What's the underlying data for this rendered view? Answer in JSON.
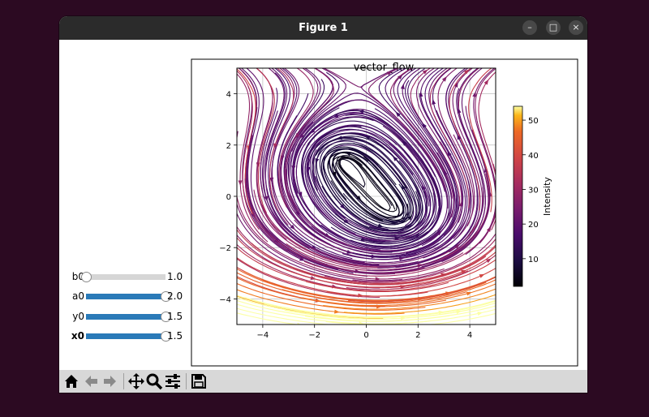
{
  "window": {
    "title": "Figure 1",
    "controls": {
      "minimize": "–",
      "maximize": "□",
      "close": "×"
    }
  },
  "sliders": [
    {
      "name": "b0",
      "value_text": "1.0",
      "fraction": 0.0,
      "bold": false
    },
    {
      "name": "a0",
      "value_text": "2.0",
      "fraction": 1.0,
      "bold": false
    },
    {
      "name": "y0",
      "value_text": "1.5",
      "fraction": 1.0,
      "bold": false
    },
    {
      "name": "x0",
      "value_text": "1.5",
      "fraction": 1.0,
      "bold": true
    }
  ],
  "toolbar": {
    "buttons": [
      "home-icon",
      "back-arrow-icon",
      "forward-arrow-icon",
      "pan-move-icon",
      "zoom-magnifier-icon",
      "subplots-config-icon",
      "save-disk-icon"
    ]
  },
  "colors": {
    "slider_fill": "#2a7ab8",
    "colormap": "inferno"
  },
  "chart_data": {
    "type": "streamplot",
    "title": "vector_flow",
    "xlabel": "",
    "ylabel": "",
    "xlim": [
      -5,
      5
    ],
    "ylim": [
      -5,
      5
    ],
    "xticks": [
      "−4",
      "−2",
      "0",
      "2",
      "4"
    ],
    "yticks": [
      "4",
      "2",
      "0",
      "−2",
      "−4"
    ],
    "grid": true,
    "field": {
      "centers": [
        [
          -1.2,
          1.5
        ],
        [
          1.4,
          -0.9
        ]
      ],
      "saddle": [
        0.5,
        0.3
      ]
    },
    "colorbar": {
      "label": "Intensity",
      "range": [
        2,
        54
      ],
      "ticks": [
        "50",
        "40",
        "30",
        "20",
        "10"
      ]
    }
  }
}
